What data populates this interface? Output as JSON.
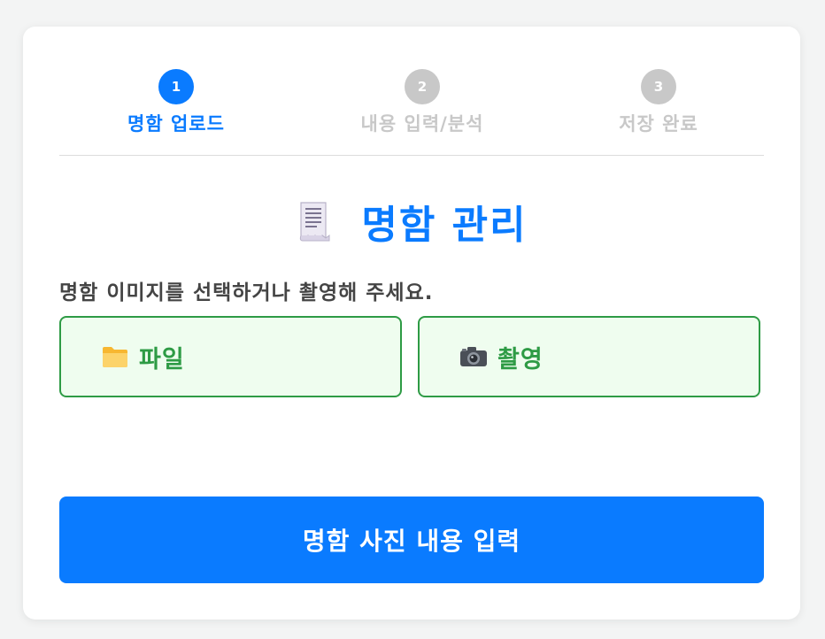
{
  "stepper": {
    "steps": [
      {
        "number": "1",
        "label": "명함 업로드",
        "state": "active"
      },
      {
        "number": "2",
        "label": "내용 입력/분석",
        "state": "inactive"
      },
      {
        "number": "3",
        "label": "저장 완료",
        "state": "inactive"
      }
    ]
  },
  "header": {
    "icon": "receipt-icon",
    "title": "명함 관리"
  },
  "instruction": "명함 이미지를 선택하거나 촬영해 주세요.",
  "options": {
    "file": {
      "icon": "folder-icon",
      "label": "파일"
    },
    "camera": {
      "icon": "camera-icon",
      "label": "촬영"
    }
  },
  "primary_button": {
    "label": "명함 사진 내용 입력"
  },
  "colors": {
    "accent": "#0a7bff",
    "inactive": "#c8c8c8",
    "option_border": "#2e9b45",
    "option_bg": "#effdef",
    "option_text": "#2e9b45"
  }
}
